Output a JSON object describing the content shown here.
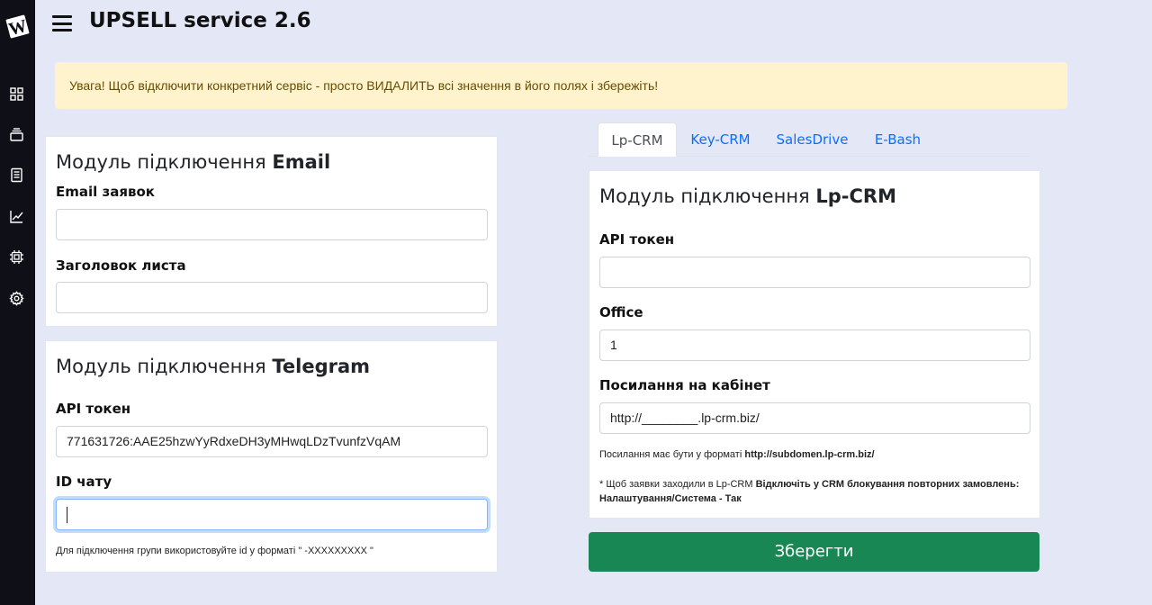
{
  "header": {
    "title": "UPSELL service 2.6"
  },
  "sidebar": {
    "items": [
      {
        "icon": "grid-icon"
      },
      {
        "icon": "layers-icon"
      },
      {
        "icon": "document-icon"
      },
      {
        "icon": "chart-icon"
      },
      {
        "icon": "chip-icon"
      },
      {
        "icon": "gear-icon"
      }
    ]
  },
  "alert": {
    "text": "Увага! Щоб відключити конкретний сервіс - просто ВИДАЛИТЬ всі значення в його полях і збережіть!"
  },
  "email_module": {
    "title_prefix": "Модуль підключення ",
    "title_bold": "Email",
    "field1_label": "Email заявок",
    "field1_value": "",
    "field2_label": "Заголовок листа",
    "field2_value": ""
  },
  "telegram_module": {
    "title_prefix": "Модуль підключення ",
    "title_bold": "Telegram",
    "token_label": "API токен",
    "token_value": "771631726:AAE25hzwYyRdxeDH3yMHwqLDzTvunfzVqAM",
    "chat_label": "ID чату",
    "chat_value": "",
    "hint": "Для підключення групи використовуйте id у форматі \" -XXXXXXXXX \""
  },
  "tabs": [
    {
      "label": "Lp-CRM",
      "active": true
    },
    {
      "label": "Key-CRM",
      "active": false
    },
    {
      "label": "SalesDrive",
      "active": false
    },
    {
      "label": "E-Bash",
      "active": false
    }
  ],
  "lpcrm_module": {
    "title_prefix": "Модуль підключення ",
    "title_bold": "Lp-CRM",
    "token_label": "API токен",
    "token_value": "",
    "office_label": "Office",
    "office_value": "1",
    "link_label": "Посилання на кабінет",
    "link_value": "http://________.lp-crm.biz/",
    "format_hint_prefix": "Посилання має бути у форматі ",
    "format_hint_bold": "http://subdomen.lp-crm.biz/",
    "note_prefix": "* Щоб заявки заходили в Lp-CRM ",
    "note_bold": "Відключіть у CRM блокування повторних замовлень: Налаштування/Система - Так"
  },
  "save_button": {
    "label": "Зберегти"
  },
  "colors": {
    "sidebar": "#0f1017",
    "background": "#e4e8f6",
    "alert_bg": "#fff3cd",
    "alert_text": "#664d03",
    "link": "#0d6efd",
    "save": "#198754"
  }
}
